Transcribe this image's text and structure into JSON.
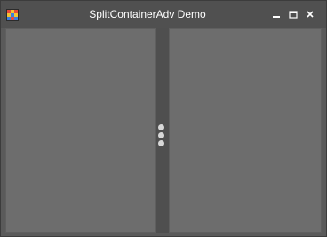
{
  "window": {
    "title": "SplitContainerAdv Demo",
    "icon": "app-grid-icon",
    "controls": {
      "minimize_icon": "minimize-icon",
      "maximize_icon": "maximize-icon",
      "close_icon": "close-icon"
    }
  },
  "split_container": {
    "orientation": "vertical",
    "grip_icon": "three-dots-vertical-icon"
  },
  "colors": {
    "titlebar": "#505050",
    "panel": "#6d6d6d",
    "splitter": "#4f4f4f",
    "grip_dot": "#d8d8d8",
    "title_text": "#ffffff"
  }
}
